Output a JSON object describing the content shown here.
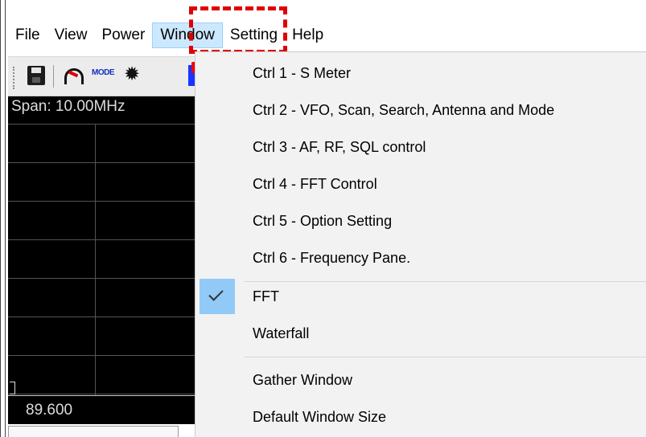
{
  "menubar": {
    "items": [
      "File",
      "View",
      "Power",
      "Window",
      "Setting",
      "Help"
    ],
    "active": "Window"
  },
  "toolbar": {
    "mode_label": "MODE",
    "icons": [
      "save-icon",
      "dial-icon",
      "mode-icon",
      "gear-icon",
      "transmit-icon"
    ]
  },
  "spectrum": {
    "span_text": "Span:  10.00MHz",
    "frequency_text": "89.600"
  },
  "dropdown": {
    "items": [
      {
        "label": "Ctrl 1 - S Meter",
        "checked": false
      },
      {
        "label": "Ctrl 2 - VFO, Scan, Search, Antenna and Mode",
        "checked": false
      },
      {
        "label": "Ctrl 3 - AF, RF, SQL control",
        "checked": false
      },
      {
        "label": "Ctrl 4 - FFT Control",
        "checked": false
      },
      {
        "label": "Ctrl 5 - Option Setting",
        "checked": false
      },
      {
        "label": "Ctrl 6 - Frequency Pane.",
        "checked": false
      },
      {
        "label": "FFT",
        "checked": true
      },
      {
        "label": "Waterfall",
        "checked": false
      },
      {
        "label": "Gather Window",
        "checked": false
      },
      {
        "label": "Default Window Size",
        "checked": false
      }
    ]
  },
  "colors": {
    "highlight_box": "#e00000",
    "menu_active_bg": "#cce8ff",
    "check_bg": "#91c9f7",
    "spectrum_bg": "#000000"
  }
}
